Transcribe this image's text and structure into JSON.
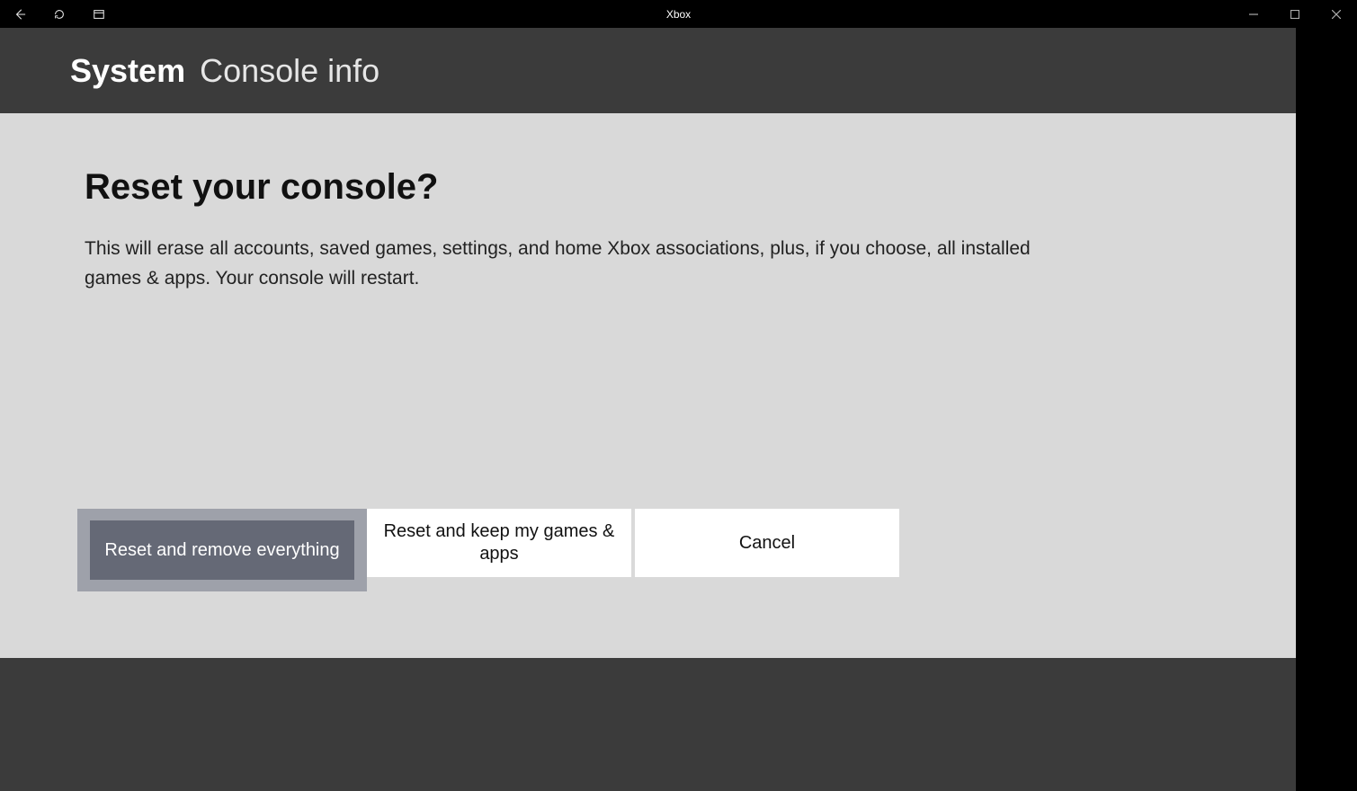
{
  "titlebar": {
    "app_name": "Xbox"
  },
  "header": {
    "section": "System",
    "page": "Console info"
  },
  "dialog": {
    "heading": "Reset your console?",
    "description": "This will erase all accounts, saved games, settings, and home Xbox associations, plus, if you choose, all installed games & apps. Your console will restart."
  },
  "buttons": {
    "reset_remove": "Reset and remove everything",
    "reset_keep": "Reset and keep my games & apps",
    "cancel": "Cancel"
  }
}
